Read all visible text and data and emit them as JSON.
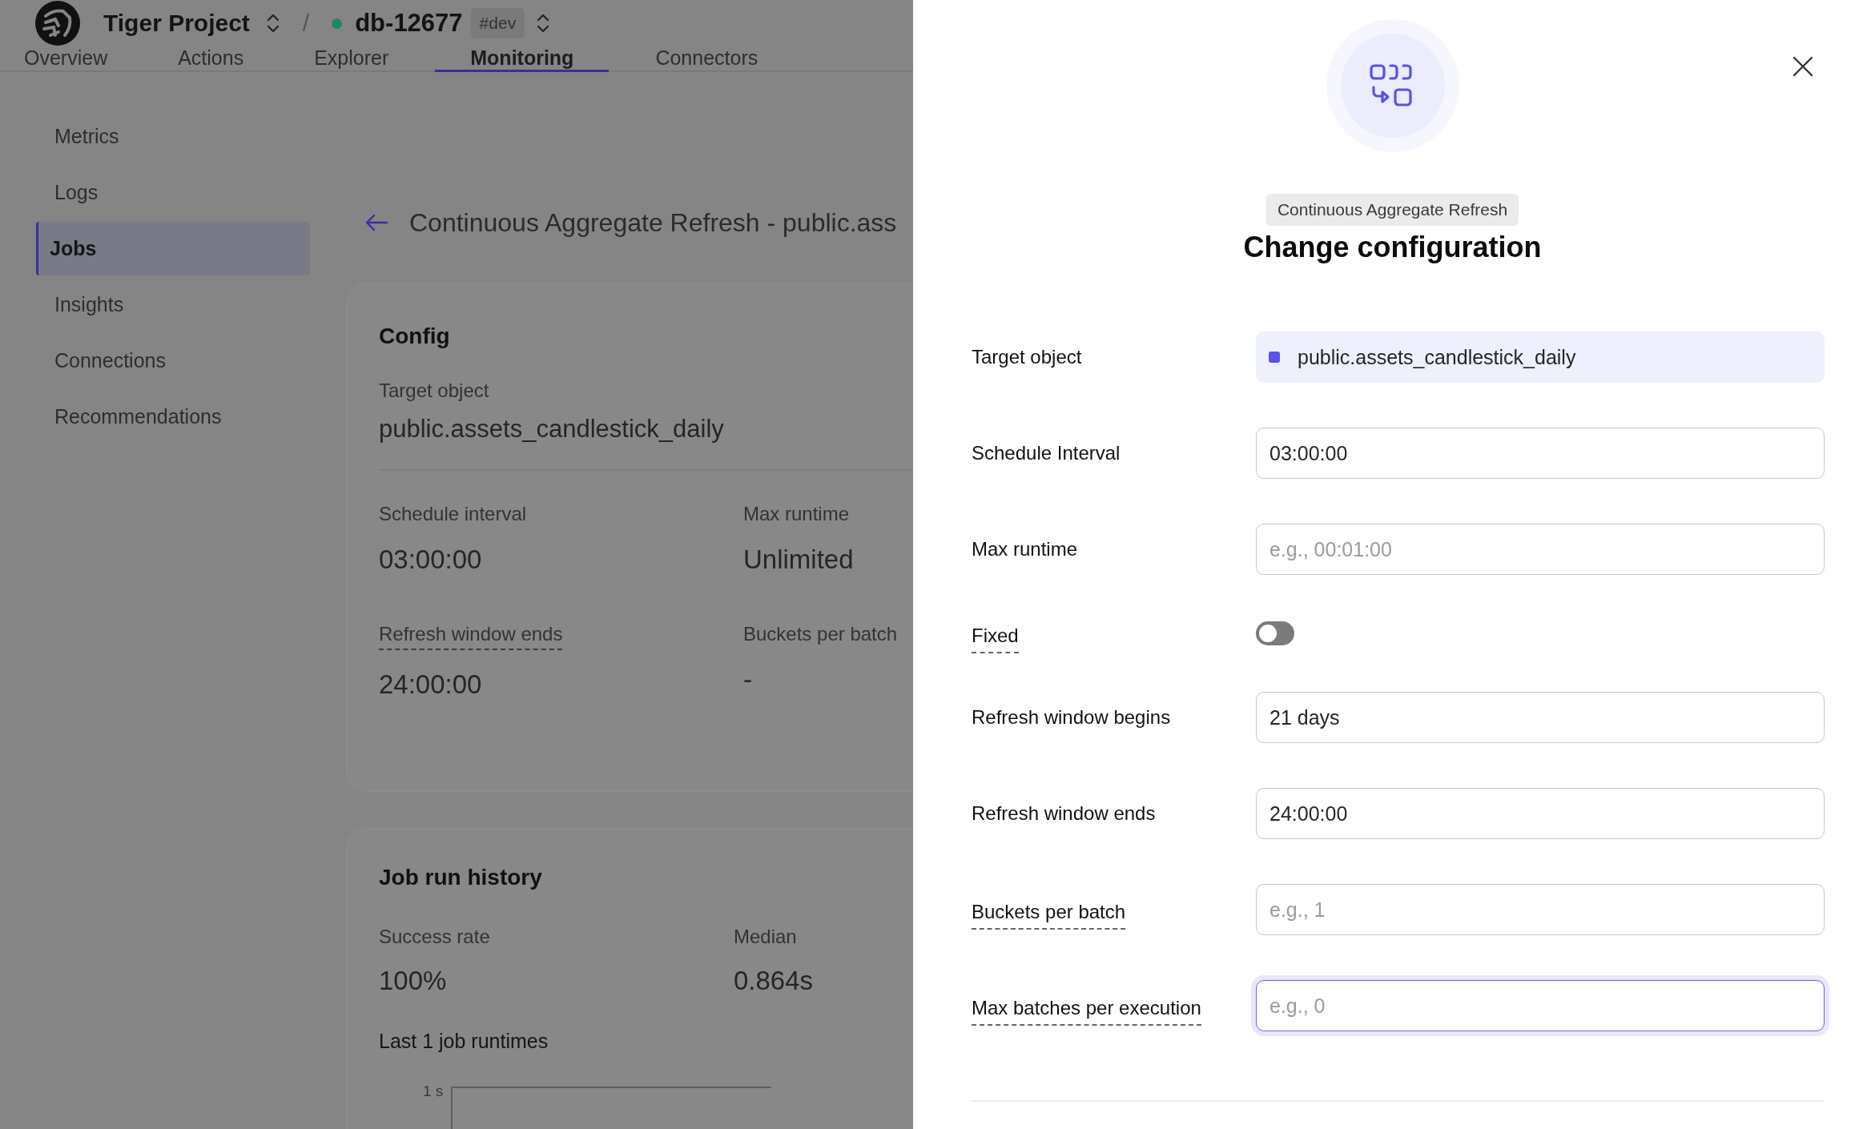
{
  "header": {
    "project": "Tiger Project",
    "separator": "/",
    "service": {
      "name": "db-12677",
      "color": "#1a8a5c",
      "tag": "#dev"
    }
  },
  "tabs": [
    {
      "label": "Overview",
      "selected": false
    },
    {
      "label": "Actions",
      "selected": false
    },
    {
      "label": "Explorer",
      "selected": false
    },
    {
      "label": "Monitoring",
      "selected": true
    },
    {
      "label": "Connectors",
      "selected": false
    }
  ],
  "sidebar": {
    "items": [
      {
        "label": "Metrics",
        "selected": false
      },
      {
        "label": "Logs",
        "selected": false
      },
      {
        "label": "Jobs",
        "selected": true
      },
      {
        "label": "Insights",
        "selected": false
      },
      {
        "label": "Connections",
        "selected": false
      },
      {
        "label": "Recommendations",
        "selected": false
      }
    ]
  },
  "page": {
    "title": "Continuous Aggregate Refresh - public.ass",
    "config": {
      "title": "Config",
      "target_label": "Target object",
      "target_value": "public.assets_candlestick_daily",
      "stats": [
        {
          "label": "Schedule interval",
          "value": "03:00:00",
          "hint": false
        },
        {
          "label": "Max runtime",
          "value": "Unlimited",
          "hint": false
        },
        {
          "label": "Refresh window ends",
          "value": "24:00:00",
          "hint": true
        },
        {
          "label": "Buckets per batch",
          "value": "-",
          "hint": false
        }
      ]
    },
    "history": {
      "title": "Job run history",
      "stats": [
        {
          "label": "Success rate",
          "value": "100%"
        },
        {
          "label": "Median",
          "value": "0.864s"
        }
      ],
      "chart_title": "Last 1 job runtimes",
      "y_tick_label": "1 s"
    }
  },
  "drawer": {
    "badge": "Continuous Aggregate Refresh",
    "title": "Change configuration",
    "fields": [
      {
        "kind": "target",
        "label": "Target object",
        "value": "public.assets_candlestick_daily",
        "hint": false
      },
      {
        "kind": "input",
        "label": "Schedule Interval",
        "value": "03:00:00",
        "hint": false,
        "focused": false
      },
      {
        "kind": "input",
        "label": "Max runtime",
        "placeholder": "e.g., 00:01:00",
        "hint": false,
        "focused": false
      },
      {
        "kind": "toggle",
        "label": "Fixed",
        "on": false,
        "hint": true
      },
      {
        "kind": "input",
        "label": "Refresh window begins",
        "value": "21 days",
        "hint": false,
        "focused": false
      },
      {
        "kind": "input",
        "label": "Refresh window ends",
        "value": "24:00:00",
        "hint": false,
        "focused": false
      },
      {
        "kind": "input",
        "label": "Buckets per batch",
        "placeholder": "e.g., 1",
        "hint": true,
        "focused": false
      },
      {
        "kind": "input",
        "label": "Max batches per execution",
        "placeholder": "e.g., 0",
        "hint": true,
        "focused": true
      }
    ]
  }
}
